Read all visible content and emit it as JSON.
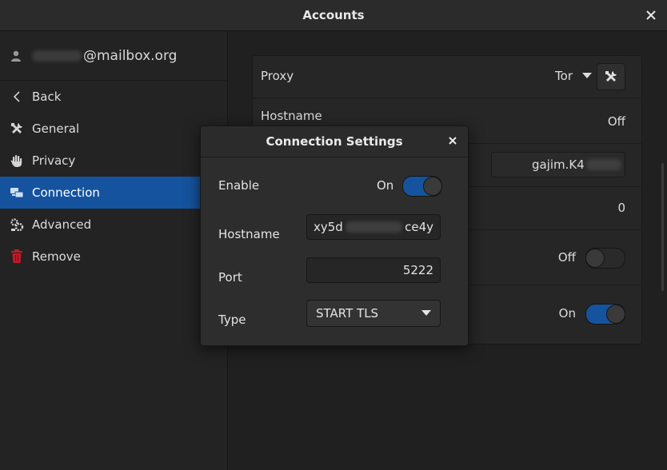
{
  "window": {
    "title": "Accounts"
  },
  "sidebar": {
    "account_suffix": "@mailbox.org",
    "items": [
      {
        "label": "Back",
        "icon": "chevron-left-icon"
      },
      {
        "label": "General",
        "icon": "tools-icon"
      },
      {
        "label": "Privacy",
        "icon": "hand-icon"
      },
      {
        "label": "Connection",
        "icon": "network-icon"
      },
      {
        "label": "Advanced",
        "icon": "gears-icon"
      },
      {
        "label": "Remove",
        "icon": "trash-icon"
      }
    ],
    "active_index": 3
  },
  "settings": {
    "proxy_label": "Proxy",
    "proxy_value": "Tor",
    "hostname_label": "Hostname",
    "hostname_value": "Off",
    "resource_value_prefix": "gajim.K4",
    "priority_value": "0",
    "switch_off_label": "Off",
    "switch_on_label": "On"
  },
  "dialog": {
    "title": "Connection Settings",
    "enable_label": "Enable",
    "enable_state": "On",
    "hostname_label": "Hostname",
    "hostname_start": "xy5d",
    "hostname_end": "ce4y",
    "port_label": "Port",
    "port_value": "5222",
    "type_label": "Type",
    "type_value": "START TLS"
  },
  "colors": {
    "accent": "#15539e",
    "remove_icon": "#c01c28"
  }
}
